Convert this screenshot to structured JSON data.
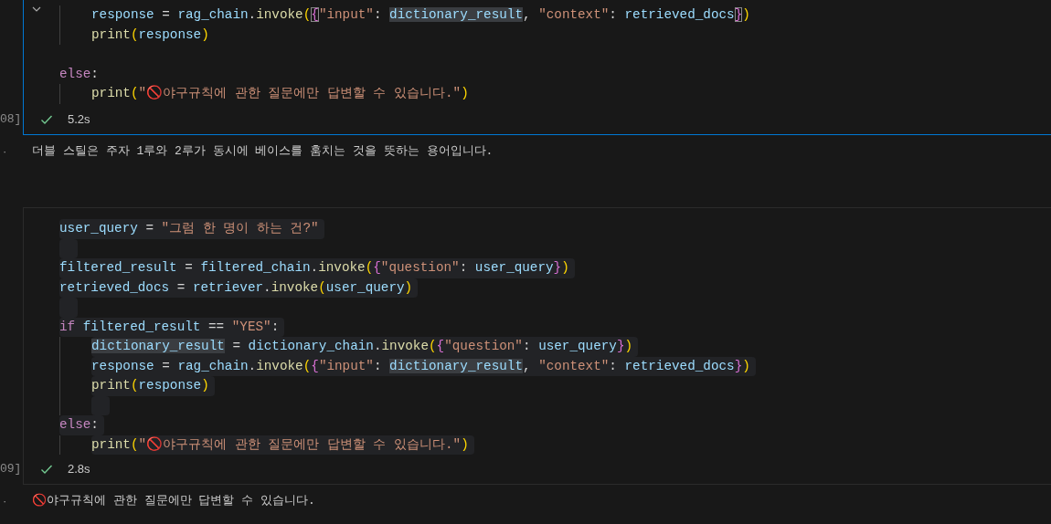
{
  "cells": [
    {
      "selected": true,
      "collapsible": true,
      "count": "08]",
      "lines": [
        {
          "kind": "block",
          "children": [
            {
              "kind": "code",
              "selection": false,
              "tokens": [
                {
                  "text": "response",
                  "kind": "var"
                },
                {
                  "text": " = ",
                  "kind": "op"
                },
                {
                  "text": "rag_chain",
                  "kind": "var"
                },
                {
                  "text": ".",
                  "kind": "op"
                },
                {
                  "text": "invoke",
                  "kind": "func"
                },
                {
                  "text": "(",
                  "kind": "b1"
                },
                {
                  "text": "{",
                  "kind": "b2",
                  "matched": true
                },
                {
                  "text": "\"input\"",
                  "kind": "str"
                },
                {
                  "text": ": ",
                  "kind": "op"
                },
                {
                  "text": "dictionary_result",
                  "kind": "var",
                  "highlighted": true
                },
                {
                  "text": ", ",
                  "kind": "op"
                },
                {
                  "text": "\"context\"",
                  "kind": "str"
                },
                {
                  "text": ": ",
                  "kind": "op"
                },
                {
                  "text": "retrieved_docs",
                  "kind": "var"
                },
                {
                  "text": "}",
                  "kind": "b2",
                  "matched": true
                },
                {
                  "text": ")",
                  "kind": "b1"
                }
              ]
            },
            {
              "kind": "code",
              "selection": false,
              "tokens": [
                {
                  "text": "print",
                  "kind": "func"
                },
                {
                  "text": "(",
                  "kind": "b1"
                },
                {
                  "text": "response",
                  "kind": "var"
                },
                {
                  "text": ")",
                  "kind": "b1"
                }
              ]
            }
          ]
        },
        {
          "kind": "blank",
          "selection": false
        },
        {
          "kind": "code",
          "selection": false,
          "tokens": [
            {
              "text": "else",
              "kind": "kw"
            },
            {
              "text": ":",
              "kind": "op"
            }
          ],
          "children": [
            {
              "kind": "code",
              "selection": false,
              "tokens": [
                {
                  "text": "print",
                  "kind": "func"
                },
                {
                  "text": "(",
                  "kind": "b1"
                },
                {
                  "text": "\"🚫야구규칙에 관한 질문에만 답변할 수 있습니다.\"",
                  "kind": "str"
                },
                {
                  "text": ")",
                  "kind": "b1"
                }
              ]
            }
          ]
        }
      ],
      "status": {
        "ok": true,
        "time": "5.2s"
      },
      "output": {
        "bullet": "·",
        "text": "더블 스틸은 주자 1루와 2루가 동시에 베이스를 훔치는 것을 뜻하는 용어입니다."
      }
    },
    {
      "selected": false,
      "collapsible": false,
      "count": "09]",
      "lines": [
        {
          "kind": "code",
          "selection": true,
          "tokens": [
            {
              "text": "user_query",
              "kind": "var"
            },
            {
              "text": " = ",
              "kind": "op"
            },
            {
              "text": "\"그럼 한 명이 하는 건?\"",
              "kind": "str"
            }
          ]
        },
        {
          "kind": "blank",
          "selection": true
        },
        {
          "kind": "code",
          "selection": true,
          "tokens": [
            {
              "text": "filtered_result",
              "kind": "var"
            },
            {
              "text": " = ",
              "kind": "op"
            },
            {
              "text": "filtered_chain",
              "kind": "var"
            },
            {
              "text": ".",
              "kind": "op"
            },
            {
              "text": "invoke",
              "kind": "func"
            },
            {
              "text": "(",
              "kind": "b1"
            },
            {
              "text": "{",
              "kind": "b2"
            },
            {
              "text": "\"question\"",
              "kind": "str"
            },
            {
              "text": ": ",
              "kind": "op"
            },
            {
              "text": "user_query",
              "kind": "var"
            },
            {
              "text": "}",
              "kind": "b2"
            },
            {
              "text": ")",
              "kind": "b1"
            }
          ]
        },
        {
          "kind": "code",
          "selection": true,
          "tokens": [
            {
              "text": "retrieved_docs",
              "kind": "var"
            },
            {
              "text": " = ",
              "kind": "op"
            },
            {
              "text": "retriever",
              "kind": "var"
            },
            {
              "text": ".",
              "kind": "op"
            },
            {
              "text": "invoke",
              "kind": "func"
            },
            {
              "text": "(",
              "kind": "b1"
            },
            {
              "text": "user_query",
              "kind": "var"
            },
            {
              "text": ")",
              "kind": "b1"
            }
          ]
        },
        {
          "kind": "blank",
          "selection": true
        },
        {
          "kind": "code",
          "selection": true,
          "tokens": [
            {
              "text": "if ",
              "kind": "kw"
            },
            {
              "text": "filtered_result",
              "kind": "var"
            },
            {
              "text": " == ",
              "kind": "op"
            },
            {
              "text": "\"YES\"",
              "kind": "str"
            },
            {
              "text": ":",
              "kind": "op"
            }
          ],
          "children": [
            {
              "kind": "code",
              "selection": true,
              "tokens": [
                {
                  "text": "dictionary_result",
                  "kind": "var",
                  "highlighted": true
                },
                {
                  "text": " = ",
                  "kind": "op"
                },
                {
                  "text": "dictionary_chain",
                  "kind": "var"
                },
                {
                  "text": ".",
                  "kind": "op"
                },
                {
                  "text": "invoke",
                  "kind": "func"
                },
                {
                  "text": "(",
                  "kind": "b1"
                },
                {
                  "text": "{",
                  "kind": "b2"
                },
                {
                  "text": "\"question\"",
                  "kind": "str"
                },
                {
                  "text": ": ",
                  "kind": "op"
                },
                {
                  "text": "user_query",
                  "kind": "var"
                },
                {
                  "text": "}",
                  "kind": "b2"
                },
                {
                  "text": ")",
                  "kind": "b1"
                }
              ]
            },
            {
              "kind": "code",
              "selection": true,
              "tokens": [
                {
                  "text": "response",
                  "kind": "var"
                },
                {
                  "text": " = ",
                  "kind": "op"
                },
                {
                  "text": "rag_chain",
                  "kind": "var"
                },
                {
                  "text": ".",
                  "kind": "op"
                },
                {
                  "text": "invoke",
                  "kind": "func"
                },
                {
                  "text": "(",
                  "kind": "b1"
                },
                {
                  "text": "{",
                  "kind": "b2"
                },
                {
                  "text": "\"input\"",
                  "kind": "str"
                },
                {
                  "text": ": ",
                  "kind": "op"
                },
                {
                  "text": "dictionary_result",
                  "kind": "var",
                  "highlighted": true
                },
                {
                  "text": ", ",
                  "kind": "op"
                },
                {
                  "text": "\"context\"",
                  "kind": "str"
                },
                {
                  "text": ": ",
                  "kind": "op"
                },
                {
                  "text": "retrieved_docs",
                  "kind": "var"
                },
                {
                  "text": "}",
                  "kind": "b2"
                },
                {
                  "text": ")",
                  "kind": "b1"
                }
              ]
            },
            {
              "kind": "code",
              "selection": true,
              "tokens": [
                {
                  "text": "print",
                  "kind": "func"
                },
                {
                  "text": "(",
                  "kind": "b1"
                },
                {
                  "text": "response",
                  "kind": "var"
                },
                {
                  "text": ")",
                  "kind": "b1"
                }
              ]
            },
            {
              "kind": "blank",
              "selection": true
            }
          ]
        },
        {
          "kind": "code",
          "selection": true,
          "tokens": [
            {
              "text": "else",
              "kind": "kw"
            },
            {
              "text": ":",
              "kind": "op"
            }
          ],
          "children": [
            {
              "kind": "code",
              "selection": true,
              "tokens": [
                {
                  "text": "print",
                  "kind": "func"
                },
                {
                  "text": "(",
                  "kind": "b1"
                },
                {
                  "text": "\"🚫야구규칙에 관한 질문에만 답변할 수 있습니다.\"",
                  "kind": "str"
                },
                {
                  "text": ")",
                  "kind": "b1"
                }
              ]
            }
          ]
        }
      ],
      "status": {
        "ok": true,
        "time": "2.8s"
      },
      "output": {
        "bullet": "·",
        "text": "🚫야구규칙에 관한 질문에만 답변할 수 있습니다."
      }
    }
  ]
}
